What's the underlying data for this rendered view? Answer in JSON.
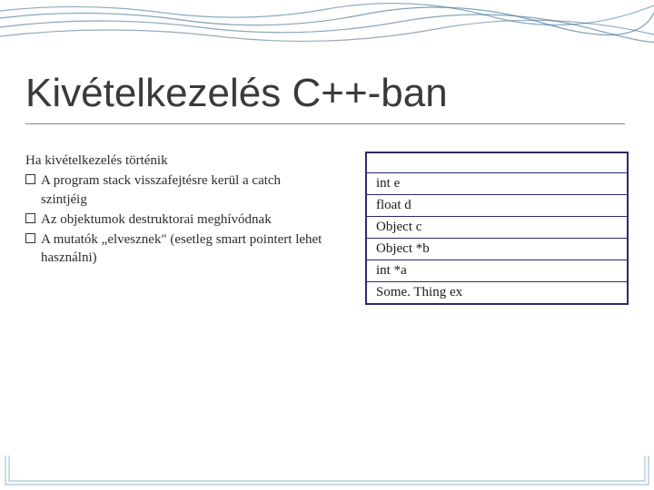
{
  "title": "Kivételkezelés C++-ban",
  "intro": "Ha kivételkezelés történik",
  "bullets": [
    "A program stack visszafejtésre kerül a catch szintjéig",
    "Az objektumok destruktorai meghívódnak",
    "A mutatók „elvesznek\" (esetleg smart pointert lehet használni)"
  ],
  "stack": {
    "rows": [
      "",
      "int e",
      "float d",
      "Object c",
      "Object *b",
      "int *a",
      "Some. Thing ex"
    ]
  }
}
